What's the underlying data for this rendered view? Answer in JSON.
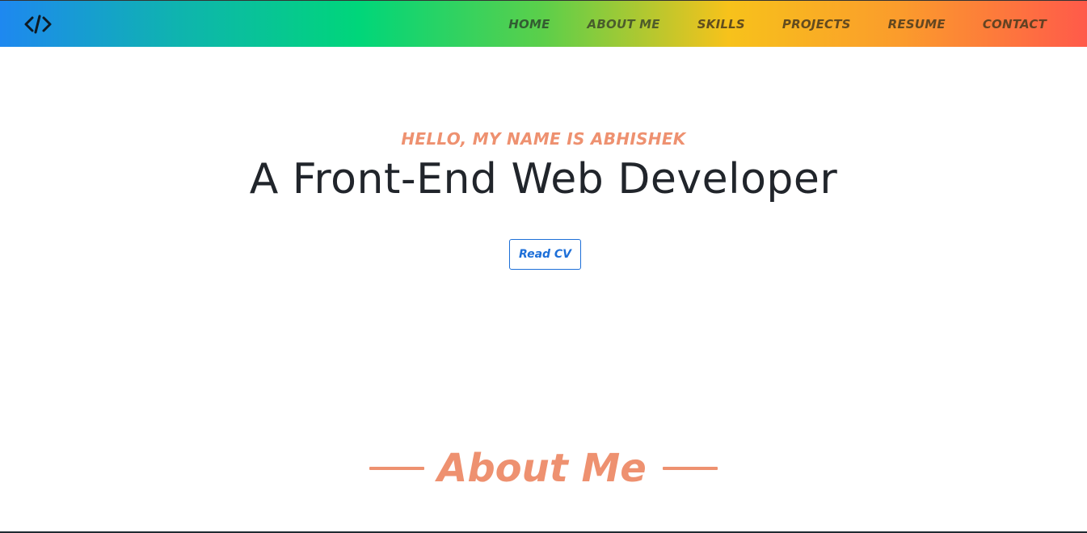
{
  "navbar": {
    "logo_icon": "code-brackets-icon",
    "items": [
      {
        "label": "HOME"
      },
      {
        "label": "ABOUT ME"
      },
      {
        "label": "SKILLS"
      },
      {
        "label": "PROJECTS"
      },
      {
        "label": "RESUME"
      },
      {
        "label": "CONTACT"
      }
    ],
    "gradient_colors": [
      "#1e88f0",
      "#00d67a",
      "#f7c21b",
      "#ff5a4a"
    ]
  },
  "hero": {
    "greeting": "HELLO, MY NAME IS ABHISHEK",
    "headline": "A Front-End Web Developer",
    "cv_button_label": "Read CV"
  },
  "about": {
    "title": "About Me"
  },
  "colors": {
    "accent": "#ee9170",
    "button_blue": "#1d6fd8",
    "text_dark": "#21252b"
  }
}
